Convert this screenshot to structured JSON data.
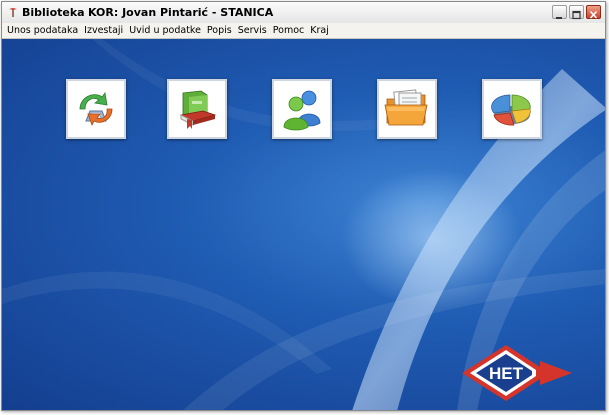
{
  "window": {
    "app_name": "Biblioteka",
    "user_label": "KOR: Jovan Pintarić - STANICA"
  },
  "menu": [
    {
      "label": "Unos podataka"
    },
    {
      "label": "Izvestaji"
    },
    {
      "label": "Uvid u podatke"
    },
    {
      "label": "Popis"
    },
    {
      "label": "Servis"
    },
    {
      "label": "Pomoc"
    },
    {
      "label": "Kraj"
    }
  ],
  "tiles": [
    {
      "icon": "sync-arrows-icon"
    },
    {
      "icon": "books-icon"
    },
    {
      "icon": "users-icon"
    },
    {
      "icon": "folder-icon"
    },
    {
      "icon": "pie-chart-icon"
    }
  ],
  "logo": {
    "text": "HET"
  },
  "colors": {
    "desktop": "#1f5cb3",
    "logo_red": "#d4342a",
    "logo_blue": "#1a3f8f"
  }
}
